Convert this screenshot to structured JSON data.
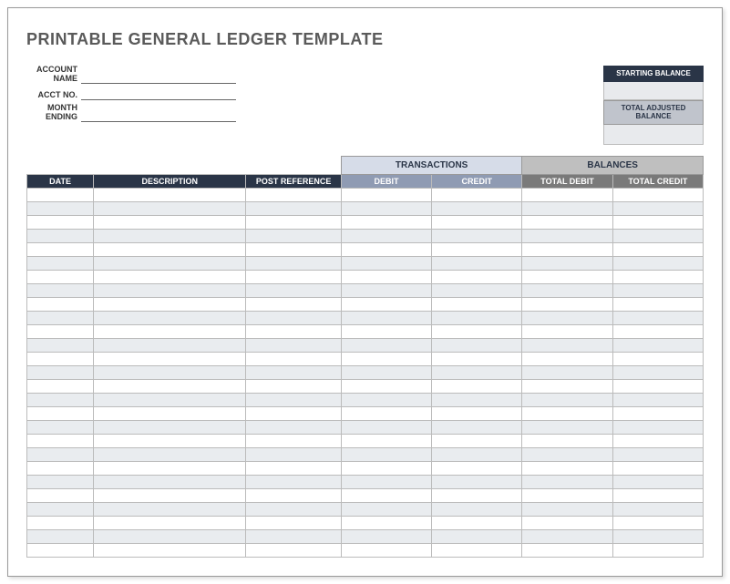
{
  "title": "PRINTABLE GENERAL LEDGER TEMPLATE",
  "fields": {
    "account_name_label": "ACCOUNT NAME",
    "account_name_value": "",
    "acct_no_label": "ACCT NO.",
    "acct_no_value": "",
    "month_ending_label": "MONTH ENDING",
    "month_ending_value": ""
  },
  "balances_box": {
    "starting_label": "STARTING BALANCE",
    "starting_value": "",
    "adjusted_label": "TOTAL ADJUSTED BALANCE",
    "adjusted_value": ""
  },
  "table": {
    "group_transactions": "TRANSACTIONS",
    "group_balances": "BALANCES",
    "col_date": "DATE",
    "col_description": "DESCRIPTION",
    "col_post_reference": "POST REFERENCE",
    "col_debit": "DEBIT",
    "col_credit": "CREDIT",
    "col_total_debit": "TOTAL DEBIT",
    "col_total_credit": "TOTAL CREDIT",
    "row_count": 27
  }
}
